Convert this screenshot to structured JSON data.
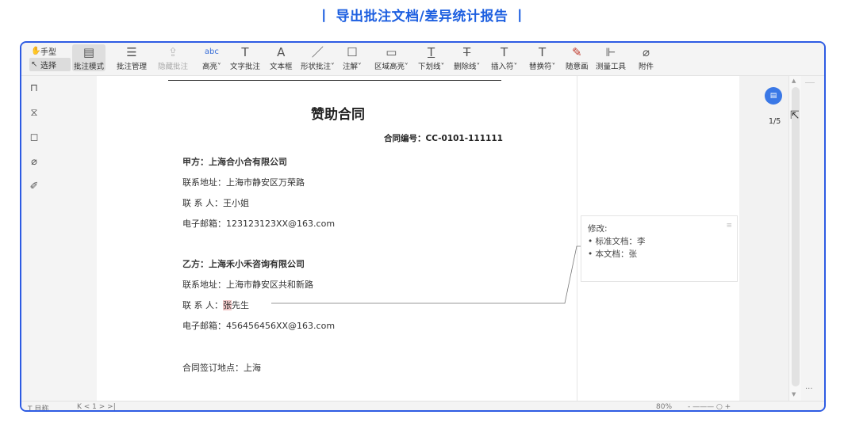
{
  "banner": {
    "title": "丨 导出批注文档/差异统计报告 丨"
  },
  "toolbar": {
    "left": [
      {
        "icon": "hand-icon",
        "glyph": "✋",
        "label": "手型"
      },
      {
        "icon": "pointer-icon",
        "glyph": "↖",
        "label": "选择"
      }
    ],
    "tools": [
      {
        "name": "annotation-mode",
        "glyph": "▤",
        "label": "批注模式"
      },
      {
        "name": "annotation-manage",
        "glyph": "☰",
        "label": "批注管理"
      },
      {
        "name": "export-annotation",
        "glyph": "⇪",
        "label": "隐藏批注"
      },
      {
        "name": "highlight",
        "glyph": "abc",
        "label": "高亮˅"
      },
      {
        "name": "text-annotation",
        "glyph": "T",
        "label": "文字批注"
      },
      {
        "name": "textbox",
        "glyph": "A",
        "label": "文本框"
      },
      {
        "name": "shape-annotation",
        "glyph": "／",
        "label": "形状批注˅"
      },
      {
        "name": "note",
        "glyph": "☐",
        "label": "注解˅"
      },
      {
        "name": "area-highlight",
        "glyph": "▭",
        "label": "区域高亮˅"
      },
      {
        "name": "underline",
        "glyph": "T",
        "label": "下划线˅"
      },
      {
        "name": "strikethrough",
        "glyph": "T",
        "label": "删除线˅"
      },
      {
        "name": "insert-mark",
        "glyph": "T",
        "label": "插入符˅"
      },
      {
        "name": "replace-mark",
        "glyph": "T",
        "label": "替换符˅"
      },
      {
        "name": "freehand",
        "glyph": "✎",
        "label": "随意画"
      },
      {
        "name": "measure",
        "glyph": "⊩",
        "label": "测量工具"
      },
      {
        "name": "attachment",
        "glyph": "⌀",
        "label": "附件"
      }
    ]
  },
  "sidebar": [
    {
      "name": "bookmark-icon",
      "glyph": "⊓"
    },
    {
      "name": "thumbnail-icon",
      "glyph": "⧖"
    },
    {
      "name": "comment-panel-icon",
      "glyph": "◻"
    },
    {
      "name": "attachment-panel-icon",
      "glyph": "⌀"
    },
    {
      "name": "signature-icon",
      "glyph": "✐"
    }
  ],
  "document": {
    "title": "赞助合同",
    "contract_no": "合同编号：CC-0101-111111",
    "party_a": {
      "label": "甲方：上海合小合有限公司",
      "address": "联系地址：上海市静安区万荣路",
      "contact": "联  系  人：王小姐",
      "email": "电子邮箱：123123123XX@163.com"
    },
    "party_b": {
      "label": "乙方：上海禾小禾咨询有限公司",
      "address": "联系地址：上海市静安区共和新路",
      "contact_prefix": "联  系  人：",
      "contact_highlight": "张",
      "contact_suffix": "先生",
      "email": "电子邮箱：456456456XX@163.com"
    },
    "sign_place": "合同签订地点：上海"
  },
  "comment": {
    "title": "修改:",
    "lines": [
      "• 标准文档：李",
      "• 本文档：张"
    ]
  },
  "pager": {
    "page": "1/5"
  },
  "statusbar": {
    "left": "T 目称",
    "nav": "K <    1    > >|",
    "zoom": "80%",
    "zoom_controls": "- ——— ○ +"
  }
}
